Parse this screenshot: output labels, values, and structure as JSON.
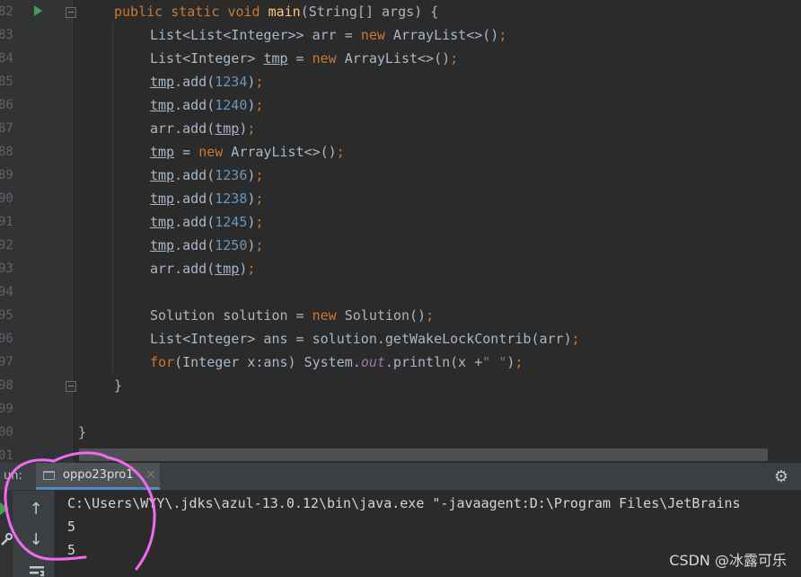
{
  "editor": {
    "line_numbers": [
      "82",
      "83",
      "84",
      "85",
      "86",
      "87",
      "88",
      "89",
      "90",
      "91",
      "92",
      "93",
      "94",
      "95",
      "96",
      "97",
      "98",
      "99",
      "00",
      "01"
    ],
    "line1": {
      "kw_public": "public",
      "kw_static": "static",
      "kw_void": "void",
      "method": "main",
      "params": "(String[] args) {"
    },
    "line2": {
      "pre": "List<List<Integer>> arr = ",
      "kw_new": "new",
      "post": " ArrayList<>()",
      ";": ";"
    },
    "line3": {
      "pre": "List<Integer> ",
      "var": "tmp",
      "eq": " = ",
      "kw_new": "new",
      "post": " ArrayList<>()",
      "semi": ";"
    },
    "line4": {
      "var": "tmp",
      "call": ".add(",
      "num": "1234",
      "close": ")",
      "semi": ";"
    },
    "line5": {
      "var": "tmp",
      "call": ".add(",
      "num": "1240",
      "close": ")",
      "semi": ";"
    },
    "line6": {
      "pre": "arr.add(",
      "var": "tmp",
      "close": ")",
      "semi": ";"
    },
    "line7": {
      "var": "tmp",
      "eq": " = ",
      "kw_new": "new",
      "post": " ArrayList<>()",
      "semi": ";"
    },
    "line8": {
      "var": "tmp",
      "call": ".add(",
      "num": "1236",
      "close": ")",
      "semi": ";"
    },
    "line9": {
      "var": "tmp",
      "call": ".add(",
      "num": "1238",
      "close": ")",
      "semi": ";"
    },
    "line10": {
      "var": "tmp",
      "call": ".add(",
      "num": "1245",
      "close": ")",
      "semi": ";"
    },
    "line11": {
      "var": "tmp",
      "call": ".add(",
      "num": "1250",
      "close": ")",
      "semi": ";"
    },
    "line12": {
      "pre": "arr.add(",
      "var": "tmp",
      "close": ")",
      "semi": ";"
    },
    "line14": {
      "pre": "Solution solution = ",
      "kw_new": "new",
      "post": " Solution()",
      "semi": ";"
    },
    "line15": {
      "pre": "List<Integer> ans = solution.getWakeLockContrib(arr)",
      "semi": ";"
    },
    "line16": {
      "kw_for": "for",
      "pre": "(Integer x:ans) System.",
      "field": "out",
      "mid": ".println(x +",
      "str": "\" \"",
      "close": ")",
      "semi": ";"
    },
    "line17": {
      "text": "}"
    },
    "line19": {
      "text": "}"
    }
  },
  "run_panel": {
    "label": "un:",
    "tab_label": "oppo23pro1",
    "tab_close": "×",
    "gear_icon": "⚙",
    "up_icon": "↑",
    "down_icon": "↓",
    "console": [
      "C:\\Users\\WYY\\.jdks\\azul-13.0.12\\bin\\java.exe \"-javaagent:D:\\Program Files\\JetBrains",
      "5",
      "5"
    ]
  },
  "watermark": "CSDN @冰露可乐",
  "colors": {
    "annotation": "#f06af0",
    "accent": "#4a88c7"
  }
}
